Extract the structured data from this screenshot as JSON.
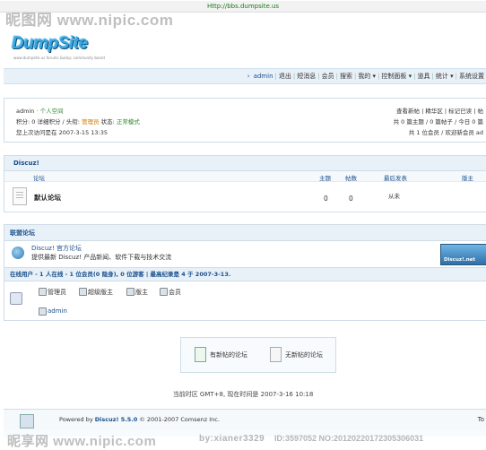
{
  "browser": {
    "url": "Http://bbs.dumpsite.us"
  },
  "watermarks": {
    "top": "昵图网 www.nipic.com",
    "bottom": "昵享网 www.nipic.com",
    "bottom_code": "ID:3597052 NO:20120220172305306031",
    "bottom_user": "by:xianer3329"
  },
  "logo": {
    "text": "DumpSite",
    "subtitle": "www.dumpsite.us  forums &amp; community board"
  },
  "topnav": {
    "items": [
      "admin",
      "退出",
      "短消息",
      "会员",
      "搜索",
      "我的 ▾",
      "控制面板 ▾",
      "道具",
      "统计 ▾",
      "系统设置"
    ]
  },
  "userinfo": {
    "username": "admin",
    "space_link": "· 个人空间",
    "points_label": "积分: 0 详细积分 / 头衔:",
    "title_value": "管理员",
    "status_label": "状态:",
    "status_value": "正常模式",
    "last_visit": "您上次访问是在 2007-3-15 13:35",
    "right_links": "查看新帖 | 精华区 | 标记已读 | 帖",
    "right_stats": "共 0 篇主题 / 0 篇帖子 / 今日 0 篇",
    "right_members": "共 1 位会员 / 欢迎新会员 ad"
  },
  "forum": {
    "category": "Discuz!",
    "columns": {
      "forum": "论坛",
      "topics": "主题",
      "posts": "帖数",
      "last_post": "最后发表",
      "moderator": "版主"
    },
    "rows": [
      {
        "name": "默认论坛",
        "topics": "0",
        "posts": "0",
        "last_post": "从未",
        "moderator": ""
      }
    ]
  },
  "links": {
    "header": "联盟论坛",
    "name": "Discuz! 官方论坛",
    "desc": "提供最新 Discuz! 产品新闻、软件下载与技术交流",
    "banner": "Discuz!.net"
  },
  "online": {
    "header_label": "在线用户",
    "header_text": "- 1 人在线 - 1 位会员(0 隐身), 0 位游客 | 最高纪录是 4 于 2007-3-13.",
    "legend": [
      "管理员",
      "超级版主",
      "版主",
      "会员"
    ],
    "users": [
      "admin"
    ]
  },
  "legend": {
    "new": "有新帖的论坛",
    "no_new": "无新帖的论坛"
  },
  "footer": {
    "time": "当前时区 GMT+8, 现在时间是 2007-3-16 10:18",
    "powered_prefix": "Powered by ",
    "powered_name": "Discuz! 5.5.0",
    "copyright": "© 2001-2007 Comsenz Inc.",
    "right": "To"
  },
  "colors": {
    "accent": "#1a4f8c",
    "header_bg": "#e8f1f8",
    "green": "#2e8b2e",
    "orange": "#d07700"
  }
}
